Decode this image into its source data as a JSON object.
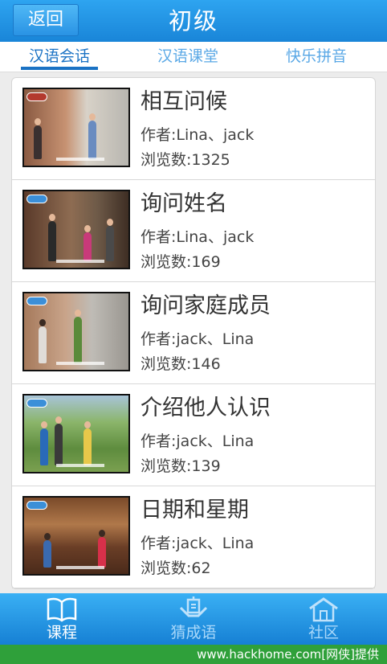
{
  "header": {
    "back_label": "返回",
    "title": "初级"
  },
  "tabs": [
    {
      "label": "汉语会话",
      "active": true
    },
    {
      "label": "汉语课堂",
      "active": false
    },
    {
      "label": "快乐拼音",
      "active": false
    }
  ],
  "lessons": [
    {
      "title": "相互问候",
      "author": "作者:Lina、jack",
      "views": "浏览数:1325"
    },
    {
      "title": "询问姓名",
      "author": "作者:Lina、jack",
      "views": "浏览数:169"
    },
    {
      "title": "询问家庭成员",
      "author": "作者:jack、Lina",
      "views": "浏览数:146"
    },
    {
      "title": "介绍他人认识",
      "author": "作者:jack、Lina",
      "views": "浏览数:139"
    },
    {
      "title": "日期和星期",
      "author": "作者:jack、Lina",
      "views": "浏览数:62"
    }
  ],
  "bottom_nav": [
    {
      "label": "课程",
      "icon": "book-icon",
      "active": true
    },
    {
      "label": "猜成语",
      "icon": "puzzle-icon",
      "active": false
    },
    {
      "label": "社区",
      "icon": "house-icon",
      "active": false
    }
  ],
  "footer": {
    "watermark": "www.hackhome.com[网侠]提供"
  },
  "colors": {
    "primary": "#1985d8",
    "active_tab": "#1a72c4",
    "footer": "#2fa03a"
  }
}
